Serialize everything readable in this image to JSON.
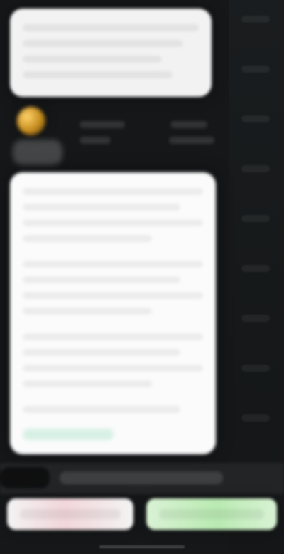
{
  "screen": {
    "type": "blurred-chat-thread"
  },
  "colors": {
    "background": "#151719",
    "card": "#fbfbfb",
    "accent_green": "#b9eab2",
    "accent_red": "#f2d6da"
  },
  "icons": {
    "avatar": "avatar-circle",
    "home_indicator": "home-indicator"
  }
}
